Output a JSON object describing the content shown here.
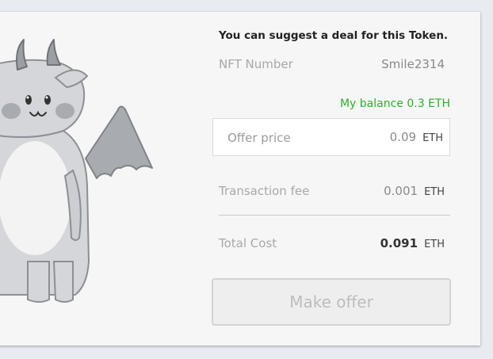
{
  "offer": {
    "headline": "You can suggest a deal for this Token.",
    "nft_label": "NFT Number",
    "nft_value": "Smile2314",
    "balance_text": "My balance 0.3 ETH",
    "offer_price_label": "Offer price",
    "offer_price_value": "0.09",
    "offer_price_unit": "ETH",
    "fee_label": "Transaction fee",
    "fee_value": "0.001",
    "fee_unit": "ETH",
    "total_label": "Total Cost",
    "total_value": "0.091",
    "total_unit": "ETH",
    "button_label": "Make offer"
  },
  "colors": {
    "balance": "#27b327",
    "mascot_body": "#d4d6d9",
    "mascot_outline": "#8c8f94"
  },
  "mascot": {
    "icon": "devil-mascot-illustration"
  }
}
